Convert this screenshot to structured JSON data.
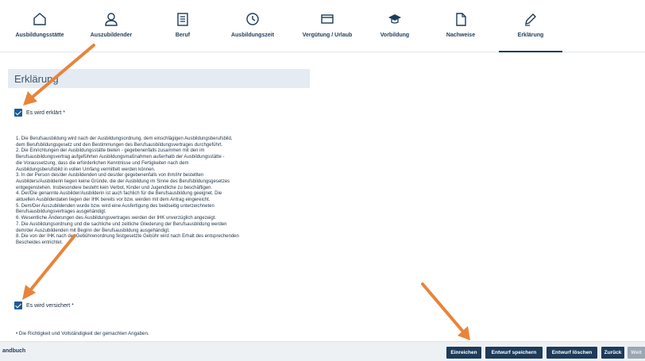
{
  "tabs": [
    {
      "label": "Ausbildungsstätte",
      "icon": "home-icon"
    },
    {
      "label": "Auszubildender",
      "icon": "person-icon"
    },
    {
      "label": "Beruf",
      "icon": "document-icon"
    },
    {
      "label": "Ausbildungszeit",
      "icon": "clock-icon"
    },
    {
      "label": "Vergütung / Urlaub",
      "icon": "credit-card-icon"
    },
    {
      "label": "Vorbildung",
      "icon": "graduation-cap-icon"
    },
    {
      "label": "Nachweise",
      "icon": "file-icon"
    },
    {
      "label": "Erklärung",
      "icon": "pen-icon",
      "active": true
    }
  ],
  "section": {
    "title": "Erklärung"
  },
  "declaration": {
    "checkbox_label": "Es wird erklärt *",
    "checked": true,
    "items": [
      "1. Die Berufsausbildung wird nach der Ausbildungsordnung, dem einschlägigen Ausbildungsberufsbild,",
      "    dem Berufsbildungsgesetz und den Bestimmungen des Berufsausbildungsvertrages durchgeführt.",
      "2. Die Einrichtungen der Ausbildungsstätte bieten - gegebenenfalls zusammen mit den im",
      "    Berufsausbildungsvertrag aufgeführten Ausbildungsmaßnahmen außerhalb der Ausbildungsstätte -",
      "    die Voraussetzung, dass die erforderlichen Kenntnisse und Fertigkeiten nach dem",
      "    Ausbildungsberufsbild in vollen Umfang vermittelt werden können.",
      "3. In der Person des/der Ausbildenden und des/der gegebenenfalls von ihm/ihr bestellten",
      "    Ausbilders/Ausbilderin liegen keine Gründe, die der Ausbildung im Sinne des Berufsbildungsgesetzes",
      "    entgegenstehen. Insbesondere besteht kein Verbot, Kinder und Jugendliche zu beschäftigen.",
      "4. Der/Die genannte Ausbilder/Ausbilderin ist auch fachlich für die Berufsausbildung geeignet. Die",
      "    aktuellen Ausbilderdaten liegen der IHK bereits vor bzw. werden mit dem Antrag eingereicht.",
      "5. Dem/Der Auszubildenden wurde bzw. wird eine Ausfertigung des beidseitig unterzeichneten",
      "    Berufsausbildungsvertrages ausgehändigt.",
      "6. Wesentliche Änderungen des Ausbildungsvertrages werden der IHK unverzüglich angezeigt.",
      "7. Die Ausbildungsordnung und die sachliche und zeitliche Gliederung der Berufsausbildung werden",
      "    dem/der Auszubildenden mit Beginn der Berufsausbildung ausgehändigt.",
      "8. Die von der IHK nach der Gebührenordnung festgesetzte Gebühr wird nach Erhalt des entsprechenden",
      "    Bescheides entrichtet."
    ]
  },
  "assurance": {
    "checkbox_label": "Es wird versichert *",
    "checked": true,
    "items": [
      "• Die Richtigkeit und Vollständigkeit der gemachten Angaben."
    ]
  },
  "footer": {
    "handbook_label": "andbuch",
    "buttons": {
      "submit": "Einreichen",
      "save_draft": "Entwurf speichern",
      "delete_draft": "Entwurf löschen",
      "back": "Zurück",
      "next": "Weit"
    }
  },
  "colors": {
    "primary": "#1d3b5a",
    "checkbox": "#1d5a96",
    "section_bg": "#e4ebf2",
    "annotation_arrow": "#e8843a"
  }
}
